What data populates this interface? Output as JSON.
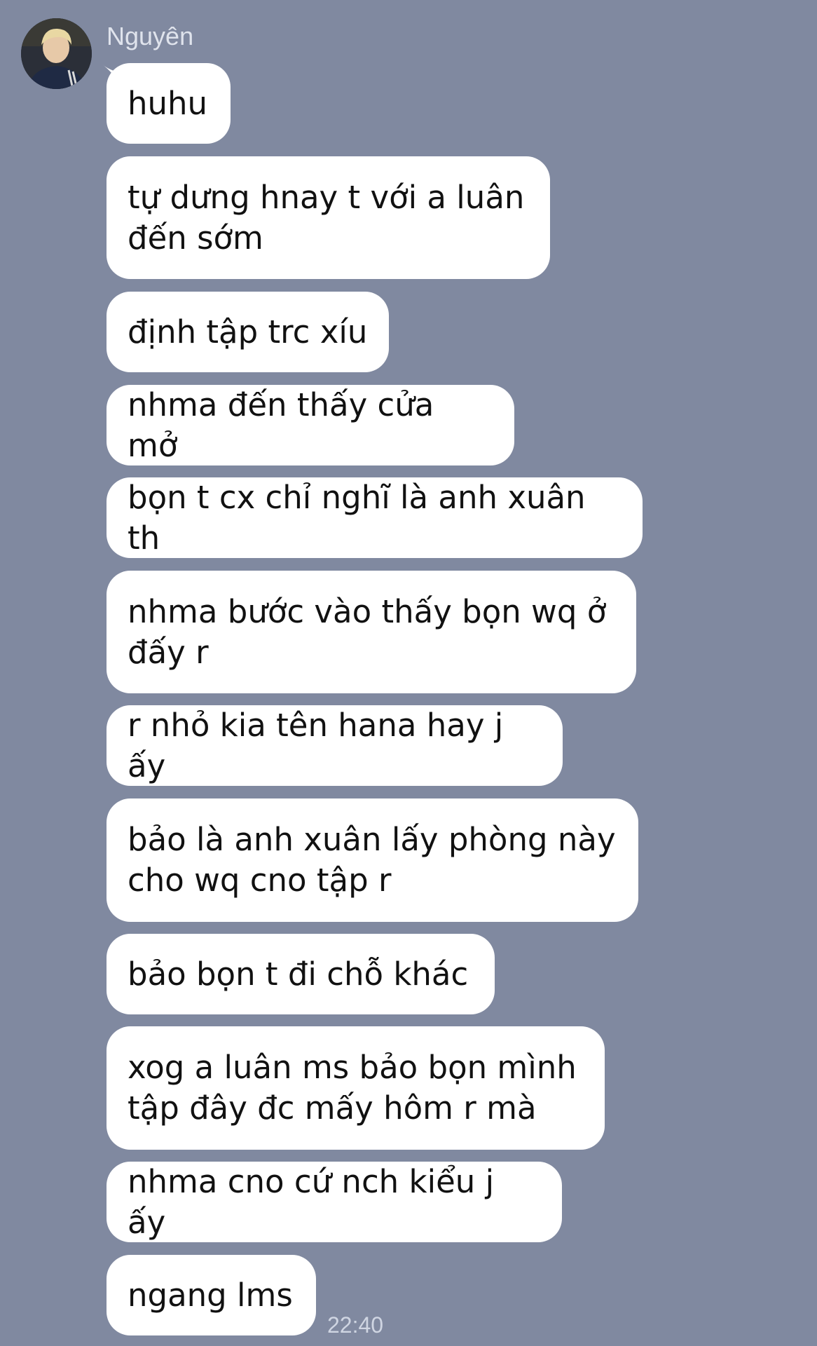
{
  "chat": {
    "sender_name": "Nguyên",
    "messages": [
      "huhu",
      "tự dưng hnay t với a luân\nđến sớm",
      "định tập trc xíu",
      "nhma đến thấy cửa mở",
      "bọn t cx chỉ nghĩ là anh xuân th",
      "nhma bước vào thấy bọn wq ở\nđấy r",
      "r nhỏ kia tên hana hay j ấy",
      "bảo là anh xuân lấy phòng này\ncho wq cno tập r",
      "bảo bọn t đi chỗ khác",
      "xog a luân ms bảo bọn mình\ntập đây đc mấy hôm r mà",
      "nhma cno cứ nch kiểu j ấy",
      "ngang lms"
    ],
    "last_time": "22:40"
  },
  "colors": {
    "background": "#8089a0",
    "bubble": "#ffffff",
    "text": "#111111"
  }
}
